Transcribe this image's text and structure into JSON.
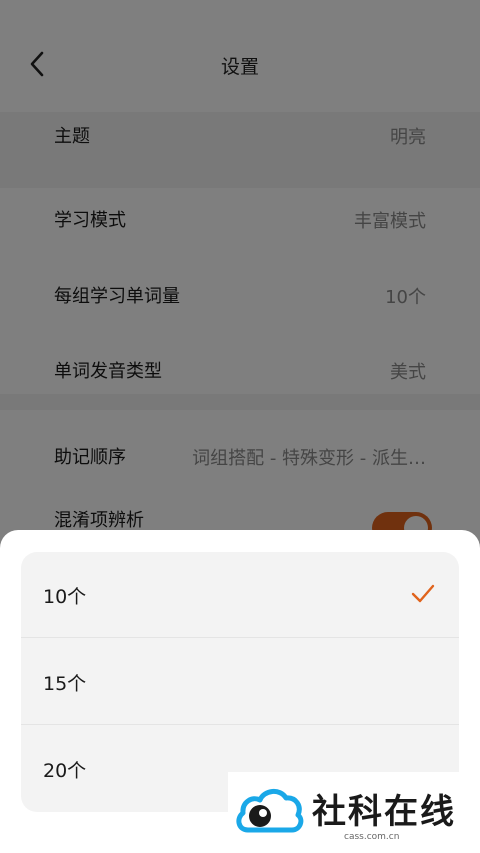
{
  "header": {
    "title": "设置"
  },
  "settings": {
    "theme": {
      "label": "主题",
      "value": "明亮"
    },
    "study_mode": {
      "label": "学习模式",
      "value": "丰富模式"
    },
    "words_per_group": {
      "label": "每组学习单词量",
      "value": "10个"
    },
    "pronunciation": {
      "label": "单词发音类型",
      "value": "美式"
    },
    "mnemonic_order": {
      "label": "助记顺序",
      "value": "词组搭配 - 特殊变形 - 派生…"
    },
    "confusion_analysis": {
      "label": "混淆项辨析",
      "enabled": true
    }
  },
  "sheet": {
    "options": [
      {
        "label": "10个",
        "selected": true
      },
      {
        "label": "15个",
        "selected": false
      },
      {
        "label": "20个",
        "selected": false
      }
    ]
  },
  "watermark": {
    "text": "社科在线",
    "url": "cass.com.cn"
  },
  "colors": {
    "accent": "#e0631c",
    "logo_blue": "#1aa8e8"
  },
  "icons": {
    "back": "chevron-left-icon",
    "check": "check-icon",
    "logo": "cloud-logo-icon"
  }
}
